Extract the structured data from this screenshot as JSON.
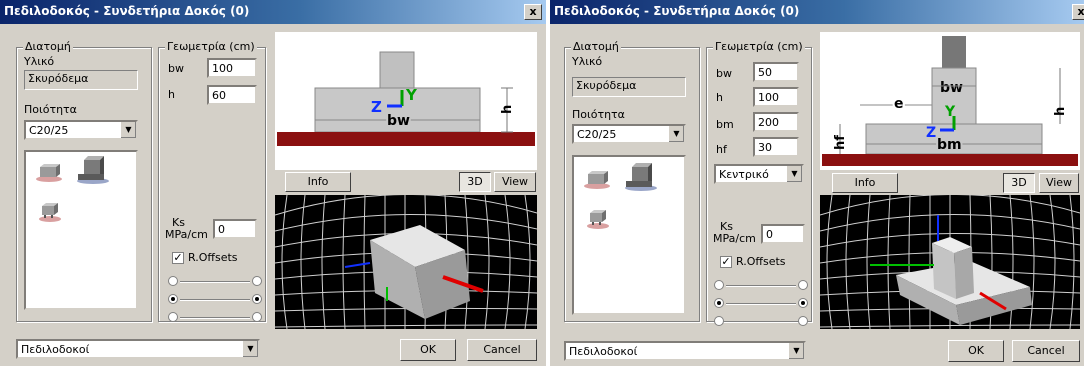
{
  "left": {
    "title": "Πεδιλοδοκός - Συνδετήρια Δοκός (0)",
    "close_label": "x",
    "section_group": "Διατομή",
    "material_label": "Υλικό",
    "material_value": "Σκυρόδεμα",
    "quality_label": "Ποιότητα",
    "quality_value": "C20/25",
    "geometry_group": "Γεωμετρία (cm)",
    "fields": [
      {
        "label": "bw",
        "value": "100"
      },
      {
        "label": "h",
        "value": "60"
      }
    ],
    "ks_label1": "Ks",
    "ks_label2": "MPa/cm",
    "ks_value": "0",
    "roffsets_label": "R.Offsets",
    "roffsets_checked": "✓",
    "diagram": {
      "h": "h",
      "bw": "bw",
      "z": "Z",
      "y": "Y"
    },
    "info_label": "Info",
    "btn_3d": "3D",
    "btn_view": "View",
    "bottom_combo": "Πεδιλοδοκοί",
    "ok_label": "OK",
    "cancel_label": "Cancel"
  },
  "right": {
    "title": "Πεδιλοδοκός - Συνδετήρια Δοκός (0)",
    "close_label": "x",
    "section_group": "Διατομή",
    "material_label": "Υλικό",
    "material_value": "Σκυρόδεμα",
    "quality_label": "Ποιότητα",
    "quality_value": "C20/25",
    "geometry_group": "Γεωμετρία (cm)",
    "fields": [
      {
        "label": "bw",
        "value": "50"
      },
      {
        "label": "h",
        "value": "100"
      },
      {
        "label": "bm",
        "value": "200"
      },
      {
        "label": "hf",
        "value": "30"
      }
    ],
    "position_value": "Κεντρικό",
    "ks_label1": "Ks",
    "ks_label2": "MPa/cm",
    "ks_value": "0",
    "roffsets_label": "R.Offsets",
    "roffsets_checked": "✓",
    "diagram": {
      "bw": "bw",
      "e": "e",
      "h": "h",
      "hf": "hf",
      "bm": "bm",
      "z": "Z",
      "y": "Y"
    },
    "info_label": "Info",
    "btn_3d": "3D",
    "btn_view": "View",
    "bottom_combo": "Πεδιλοδοκοί",
    "ok_label": "OK",
    "cancel_label": "Cancel"
  }
}
